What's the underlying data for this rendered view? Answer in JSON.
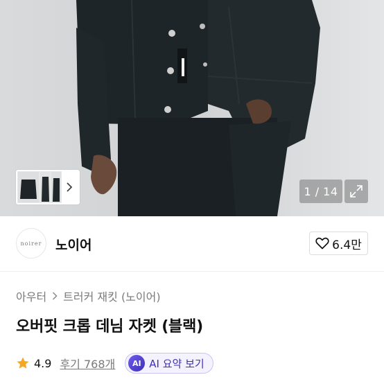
{
  "gallery": {
    "counter": "1 / 14",
    "icons": {
      "next_thumb": "chevron-right-icon",
      "expand": "expand-icon"
    }
  },
  "brand": {
    "logo_text": "noirer",
    "name": "노이어",
    "likes": "6.4만",
    "like_icon": "heart-icon"
  },
  "breadcrumb": {
    "items": [
      "아우터",
      "트러커 재킷 (노이어)"
    ]
  },
  "product": {
    "title": "오버핏 크롭 데님 자켓 (블랙)",
    "rating": "4.9",
    "review_label": "후기 768개",
    "ai_badge": "AI",
    "ai_summary_label": "AI 요약 보기"
  },
  "colors": {
    "star": "#f5a623",
    "ai_accent": "#3d2fb5",
    "denim": "#1c2326"
  }
}
